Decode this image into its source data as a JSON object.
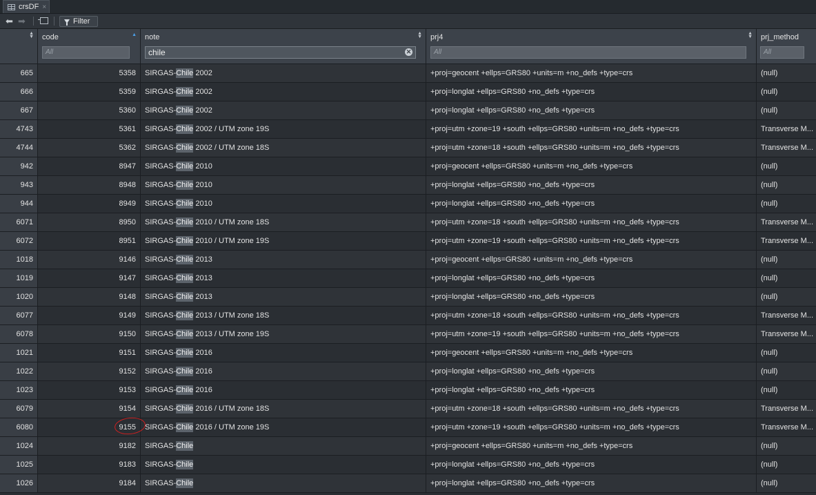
{
  "tab": {
    "title": "crsDF",
    "close": "×"
  },
  "toolbar": {
    "filter_label": "Filter"
  },
  "columns": [
    {
      "name": "",
      "filter_placeholder": ""
    },
    {
      "name": "code",
      "filter_placeholder": "All"
    },
    {
      "name": "note",
      "filter_value": "chile"
    },
    {
      "name": "prj4",
      "filter_placeholder": "All"
    },
    {
      "name": "prj_method",
      "filter_placeholder": "All"
    }
  ],
  "highlight_term": "Chile",
  "rows": [
    {
      "idx": "665",
      "code": "5358",
      "note_pre": "SIRGAS-",
      "note_post": " 2002",
      "prj4": "+proj=geocent +ellps=GRS80 +units=m +no_defs +type=crs",
      "method": "(null)"
    },
    {
      "idx": "666",
      "code": "5359",
      "note_pre": "SIRGAS-",
      "note_post": " 2002",
      "prj4": "+proj=longlat +ellps=GRS80 +no_defs +type=crs",
      "method": "(null)"
    },
    {
      "idx": "667",
      "code": "5360",
      "note_pre": "SIRGAS-",
      "note_post": " 2002",
      "prj4": "+proj=longlat +ellps=GRS80 +no_defs +type=crs",
      "method": "(null)"
    },
    {
      "idx": "4743",
      "code": "5361",
      "note_pre": "SIRGAS-",
      "note_post": " 2002 / UTM zone 19S",
      "prj4": "+proj=utm +zone=19 +south +ellps=GRS80 +units=m +no_defs +type=crs",
      "method": "Transverse M..."
    },
    {
      "idx": "4744",
      "code": "5362",
      "note_pre": "SIRGAS-",
      "note_post": " 2002 / UTM zone 18S",
      "prj4": "+proj=utm +zone=18 +south +ellps=GRS80 +units=m +no_defs +type=crs",
      "method": "Transverse M..."
    },
    {
      "idx": "942",
      "code": "8947",
      "note_pre": "SIRGAS-",
      "note_post": " 2010",
      "prj4": "+proj=geocent +ellps=GRS80 +units=m +no_defs +type=crs",
      "method": "(null)"
    },
    {
      "idx": "943",
      "code": "8948",
      "note_pre": "SIRGAS-",
      "note_post": " 2010",
      "prj4": "+proj=longlat +ellps=GRS80 +no_defs +type=crs",
      "method": "(null)"
    },
    {
      "idx": "944",
      "code": "8949",
      "note_pre": "SIRGAS-",
      "note_post": " 2010",
      "prj4": "+proj=longlat +ellps=GRS80 +no_defs +type=crs",
      "method": "(null)"
    },
    {
      "idx": "6071",
      "code": "8950",
      "note_pre": "SIRGAS-",
      "note_post": " 2010 / UTM zone 18S",
      "prj4": "+proj=utm +zone=18 +south +ellps=GRS80 +units=m +no_defs +type=crs",
      "method": "Transverse M..."
    },
    {
      "idx": "6072",
      "code": "8951",
      "note_pre": "SIRGAS-",
      "note_post": " 2010 / UTM zone 19S",
      "prj4": "+proj=utm +zone=19 +south +ellps=GRS80 +units=m +no_defs +type=crs",
      "method": "Transverse M..."
    },
    {
      "idx": "1018",
      "code": "9146",
      "note_pre": "SIRGAS-",
      "note_post": " 2013",
      "prj4": "+proj=geocent +ellps=GRS80 +units=m +no_defs +type=crs",
      "method": "(null)"
    },
    {
      "idx": "1019",
      "code": "9147",
      "note_pre": "SIRGAS-",
      "note_post": " 2013",
      "prj4": "+proj=longlat +ellps=GRS80 +no_defs +type=crs",
      "method": "(null)"
    },
    {
      "idx": "1020",
      "code": "9148",
      "note_pre": "SIRGAS-",
      "note_post": " 2013",
      "prj4": "+proj=longlat +ellps=GRS80 +no_defs +type=crs",
      "method": "(null)"
    },
    {
      "idx": "6077",
      "code": "9149",
      "note_pre": "SIRGAS-",
      "note_post": " 2013 / UTM zone 18S",
      "prj4": "+proj=utm +zone=18 +south +ellps=GRS80 +units=m +no_defs +type=crs",
      "method": "Transverse M..."
    },
    {
      "idx": "6078",
      "code": "9150",
      "note_pre": "SIRGAS-",
      "note_post": " 2013 / UTM zone 19S",
      "prj4": "+proj=utm +zone=19 +south +ellps=GRS80 +units=m +no_defs +type=crs",
      "method": "Transverse M..."
    },
    {
      "idx": "1021",
      "code": "9151",
      "note_pre": "SIRGAS-",
      "note_post": " 2016",
      "prj4": "+proj=geocent +ellps=GRS80 +units=m +no_defs +type=crs",
      "method": "(null)"
    },
    {
      "idx": "1022",
      "code": "9152",
      "note_pre": "SIRGAS-",
      "note_post": " 2016",
      "prj4": "+proj=longlat +ellps=GRS80 +no_defs +type=crs",
      "method": "(null)"
    },
    {
      "idx": "1023",
      "code": "9153",
      "note_pre": "SIRGAS-",
      "note_post": " 2016",
      "prj4": "+proj=longlat +ellps=GRS80 +no_defs +type=crs",
      "method": "(null)"
    },
    {
      "idx": "6079",
      "code": "9154",
      "note_pre": "SIRGAS-",
      "note_post": " 2016 / UTM zone 18S",
      "prj4": "+proj=utm +zone=18 +south +ellps=GRS80 +units=m +no_defs +type=crs",
      "method": "Transverse M..."
    },
    {
      "idx": "6080",
      "code": "9155",
      "note_pre": "SIRGAS-",
      "note_post": " 2016 / UTM zone 19S",
      "prj4": "+proj=utm +zone=19 +south +ellps=GRS80 +units=m +no_defs +type=crs",
      "method": "Transverse M...",
      "circled": true
    },
    {
      "idx": "1024",
      "code": "9182",
      "note_pre": "SIRGAS-",
      "note_post": "",
      "prj4": "+proj=geocent +ellps=GRS80 +units=m +no_defs +type=crs",
      "method": "(null)"
    },
    {
      "idx": "1025",
      "code": "9183",
      "note_pre": "SIRGAS-",
      "note_post": "",
      "prj4": "+proj=longlat +ellps=GRS80 +no_defs +type=crs",
      "method": "(null)"
    },
    {
      "idx": "1026",
      "code": "9184",
      "note_pre": "SIRGAS-",
      "note_post": "",
      "prj4": "+proj=longlat +ellps=GRS80 +no_defs +type=crs",
      "method": "(null)"
    }
  ]
}
